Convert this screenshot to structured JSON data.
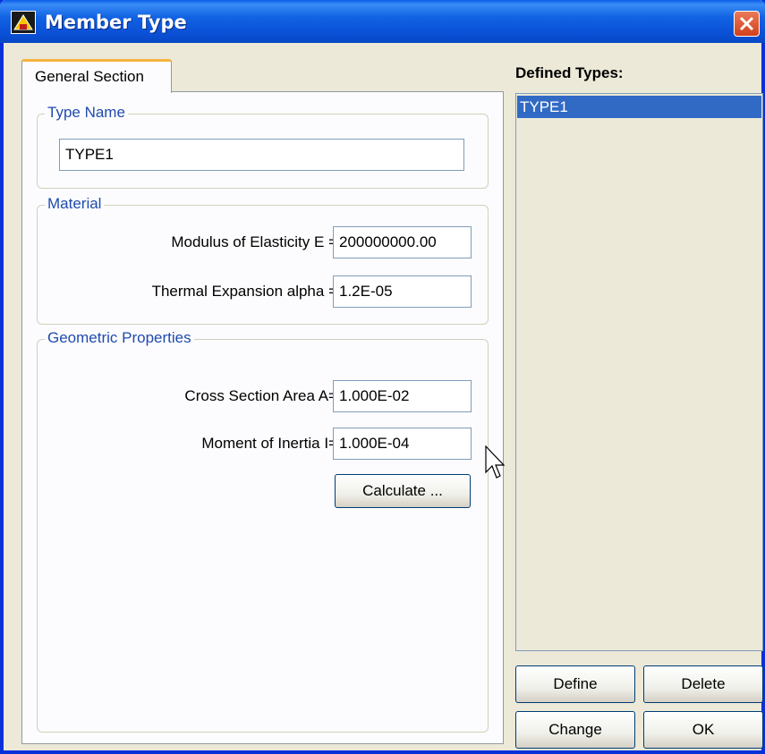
{
  "window": {
    "title": "Member Type"
  },
  "tabs": [
    {
      "label": "General Section"
    }
  ],
  "type_name": {
    "group_label": "Type Name",
    "value": "TYPE1"
  },
  "material": {
    "group_label": "Material",
    "modulus_label": "Modulus of Elasticity E =",
    "modulus_value": "200000000.00",
    "thermal_label": "Thermal Expansion alpha  =",
    "thermal_value": "1.2E-05"
  },
  "geometry": {
    "group_label": "Geometric Properties",
    "area_label": "Cross Section Area  A=",
    "area_value": "1.000E-02",
    "inertia_label": "Moment of Inertia  I=",
    "inertia_value": "1.000E-04",
    "calculate_label": "Calculate ..."
  },
  "defined_types": {
    "label": "Defined Types:",
    "items": [
      "TYPE1"
    ]
  },
  "buttons": {
    "define": "Define",
    "delete": "Delete",
    "change": "Change",
    "ok": "OK"
  },
  "colors": {
    "titlebar": "#0a4fd6",
    "selection": "#316ac5",
    "group_label": "#1f4bad",
    "tab_highlight": "#f5b33d"
  }
}
